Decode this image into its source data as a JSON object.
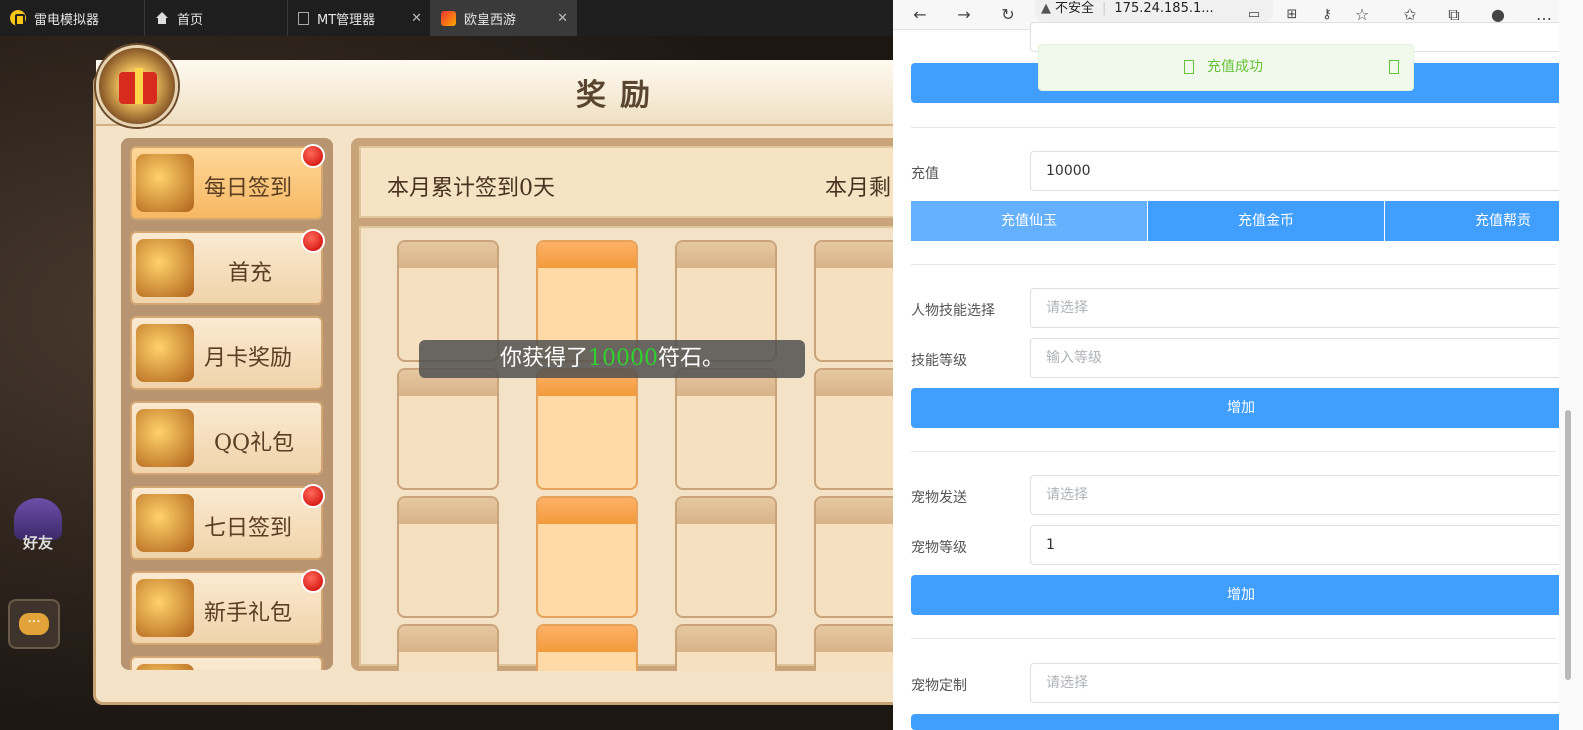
{
  "emulator": {
    "tabs": [
      {
        "label": "雷电模拟器",
        "icon": "ldplayer-logo-icon"
      },
      {
        "label": "首页",
        "icon": "home-icon"
      },
      {
        "label": "MT管理器",
        "icon": "page-icon"
      },
      {
        "label": "欧皇西游",
        "icon": "game-icon"
      }
    ]
  },
  "game": {
    "panel_title": "奖励",
    "sidebar": [
      {
        "label": "每日签到",
        "badge": true,
        "active": true
      },
      {
        "label": "首充",
        "badge": true
      },
      {
        "label": "月卡奖励",
        "badge": false
      },
      {
        "label": "QQ礼包",
        "badge": false
      },
      {
        "label": "七日签到",
        "badge": true
      },
      {
        "label": "新手礼包",
        "badge": true
      }
    ],
    "summary_left": "本月累计签到0天",
    "summary_right": "本月剩",
    "toast": {
      "prefix": "你获得了",
      "amount": "10000",
      "suffix": "符石。"
    },
    "friend_label": "好友",
    "chat_label": "···"
  },
  "browser": {
    "security_label": "不安全",
    "url": "175.24.185.1...",
    "toolbar_icons": [
      "back-icon",
      "forward-icon",
      "refresh-icon",
      "read-aloud-icon",
      "apps-icon",
      "key-icon",
      "add-favorite-icon",
      "favorites-icon",
      "collections-icon",
      "profile-icon",
      "more-icon"
    ],
    "success_message": "充值成功",
    "form": {
      "recharge_label": "充值",
      "recharge_value": "10000",
      "recharge_buttons": [
        "充值仙玉",
        "充值金币",
        "充值帮贡"
      ],
      "skill_label": "人物技能选择",
      "skill_placeholder": "请选择",
      "skill_level_label": "技能等级",
      "skill_level_placeholder": "输入等级",
      "add_label": "增加",
      "pet_send_label": "宠物发送",
      "pet_send_placeholder": "请选择",
      "pet_level_label": "宠物等级",
      "pet_level_value": "1",
      "pet_custom_label": "宠物定制",
      "pet_custom_placeholder": "请选择"
    }
  },
  "colors": {
    "primary": "#409eff",
    "primary_light": "#66b1ff",
    "success": "#67c23a",
    "badge": "#e01010",
    "toast_number": "#2fd02f"
  }
}
